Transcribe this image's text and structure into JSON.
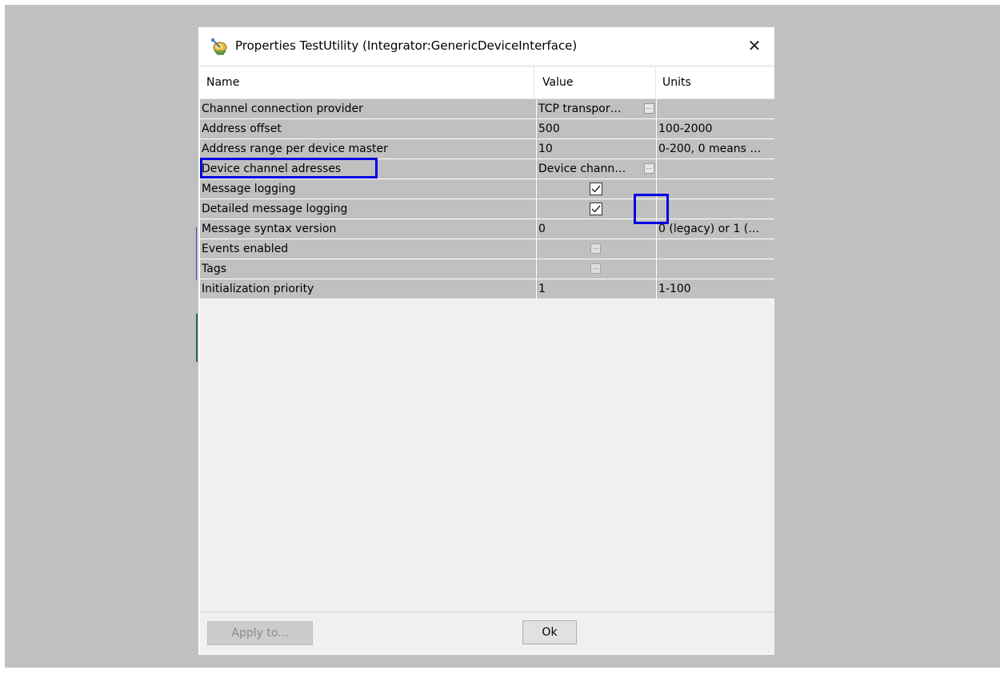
{
  "dialog": {
    "title": "Properties TestUtility (Integrator:GenericDeviceInterface)",
    "close_symbol": "✕",
    "icon": "satellite-dish-icon"
  },
  "columns": {
    "name": "Name",
    "value": "Value",
    "units": "Units"
  },
  "rows": [
    {
      "name": "Channel connection provider",
      "value": "TCP transpor…",
      "units": "",
      "control": "ellipsis"
    },
    {
      "name": "Address offset",
      "value": "500",
      "units": "100-2000",
      "control": "none"
    },
    {
      "name": "Address range per device master",
      "value": "10",
      "units": "0-200, 0 means …",
      "control": "none"
    },
    {
      "name": "Device channel adresses",
      "value": "Device chann…",
      "units": "",
      "control": "ellipsis"
    },
    {
      "name": "Message logging",
      "value": "",
      "units": "",
      "control": "checkbox",
      "checked": true
    },
    {
      "name": "Detailed message logging",
      "value": "",
      "units": "",
      "control": "checkbox",
      "checked": true
    },
    {
      "name": "Message syntax version",
      "value": "0",
      "units": "0 (legacy) or 1 (…",
      "control": "none"
    },
    {
      "name": "Events enabled",
      "value": "",
      "units": "",
      "control": "ellipsis-center"
    },
    {
      "name": "Tags",
      "value": "",
      "units": "",
      "control": "ellipsis-center"
    },
    {
      "name": "Initialization priority",
      "value": "1",
      "units": "1-100",
      "control": "none"
    }
  ],
  "ellipsis_glyph": "...",
  "footer": {
    "apply_label": "Apply to...",
    "ok_label": "Ok"
  },
  "colors": {
    "highlight": "#0000e6",
    "row_bg": "#c0c0c0"
  }
}
